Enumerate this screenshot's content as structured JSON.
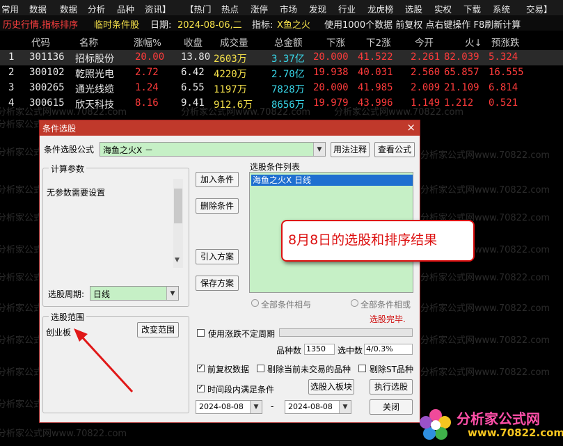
{
  "menu": [
    "常用",
    "数据",
    "数据",
    "分析",
    "品种",
    "资讯】",
    "【热门",
    "热点",
    "涨停",
    "市场",
    "发现",
    "行业",
    "龙虎榜",
    "选股",
    "实权",
    "下载",
    "系统",
    "交易】"
  ],
  "status": {
    "mode": "历史行情.指标排序",
    "cond": "临时条件股",
    "date_label": "日期:",
    "date": "2024-08-06,二",
    "indicator_label": "指标:",
    "indicator": "X鱼之火",
    "info": "使用1000个数据 前复权 点右键操作 F8刷新计算"
  },
  "table": {
    "headers": [
      "代码",
      "名称",
      "涨幅%",
      "收盘",
      "成交量",
      "总金额",
      "下涨",
      "下2涨",
      "今开",
      "火↓",
      "预涨跌"
    ],
    "rows": [
      {
        "idx": "1",
        "code": "301136",
        "name": "招标股份",
        "chg": "20.00",
        "close": "13.80",
        "vol": "2603万",
        "amt": "3.37亿",
        "d1": "20.000",
        "d2": "41.522",
        "open": "2.261",
        "fire": "82.039",
        "pred": "5.324"
      },
      {
        "idx": "2",
        "code": "300102",
        "name": "乾照光电",
        "chg": "2.72",
        "close": "6.42",
        "vol": "4220万",
        "amt": "2.70亿",
        "d1": "19.938",
        "d2": "40.031",
        "open": "2.560",
        "fire": "65.857",
        "pred": "16.555"
      },
      {
        "idx": "3",
        "code": "300265",
        "name": "通光线缆",
        "chg": "1.24",
        "close": "6.55",
        "vol": "1197万",
        "amt": "7828万",
        "d1": "20.000",
        "d2": "41.985",
        "open": "2.009",
        "fire": "21.109",
        "pred": "6.814"
      },
      {
        "idx": "4",
        "code": "300615",
        "name": "欣天科技",
        "chg": "8.16",
        "close": "9.41",
        "vol": "912.6万",
        "amt": "8656万",
        "d1": "19.979",
        "d2": "43.996",
        "open": "1.149",
        "fire": "1.212",
        "pred": "0.521"
      }
    ]
  },
  "colors": {
    "red": "#ff3b3b",
    "yellow": "#f5e14a",
    "cyan": "#38d6e8",
    "white": "#e8e8e8"
  },
  "dialog": {
    "title": "条件选股",
    "close": "×",
    "formula_label": "条件选股公式",
    "formula_value": "海鱼之火X   －",
    "btn_usage": "用法注释",
    "btn_view": "查看公式",
    "params_group": "计算参数",
    "params_text": "无参数需要设置",
    "btn_add": "加入条件",
    "btn_delete": "删除条件",
    "btn_import": "引入方案",
    "btn_save": "保存方案",
    "list_label": "选股条件列表",
    "list_item": "海鱼之火X   日线",
    "period_label": "选股周期:",
    "period_value": "日线",
    "radio_and": "全部条件相与",
    "radio_or": "全部条件相或",
    "done": "选股完毕.",
    "range_group": "选股范围",
    "range_value": "创业板",
    "btn_change_range": "改变范围",
    "use_uncertain": "使用涨跌不定周期",
    "count_label": "品种数",
    "count_value": "1350",
    "selected_label": "选中数",
    "selected_value": "4/0.3%",
    "fq_label": "前复权数据",
    "exclude_label": "剔除当前未交易的品种",
    "exclude_st": "剔除ST品种",
    "time_label": "时间段内满足条件",
    "btn_to_block": "选股入板块",
    "btn_run": "执行选股",
    "date_from": "2024-08-08",
    "date_sep": "-",
    "date_to": "2024-08-08",
    "btn_close": "关闭"
  },
  "callout": "8月8日的选股和排序结果",
  "watermark": {
    "a": "分析家公式网www.70822.com",
    "logo": "分析家公式网",
    "logo_url": "www.70822.com"
  }
}
